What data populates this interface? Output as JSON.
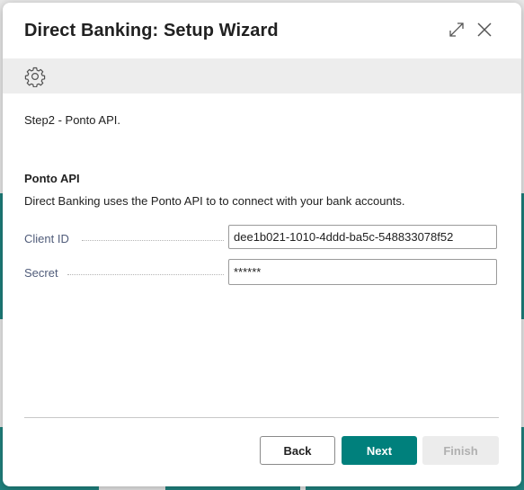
{
  "dialog": {
    "title": "Direct Banking: Setup Wizard",
    "icons": {
      "expand": "expand-icon",
      "close": "close-icon",
      "settings": "gear-icon"
    }
  },
  "step": {
    "text": "Step2 - Ponto API."
  },
  "section": {
    "title": "Ponto API",
    "description": "Direct Banking uses the Ponto API to to connect with your bank accounts."
  },
  "fields": {
    "client_id": {
      "label": "Client ID",
      "value": "dee1b021-1010-4ddd-ba5c-548833078f52"
    },
    "secret": {
      "label": "Secret",
      "value": "******"
    }
  },
  "buttons": {
    "back": "Back",
    "next": "Next",
    "finish": "Finish"
  },
  "colors": {
    "accent": "#00807c",
    "toolbar": "#ededed",
    "label": "#505c7a"
  }
}
